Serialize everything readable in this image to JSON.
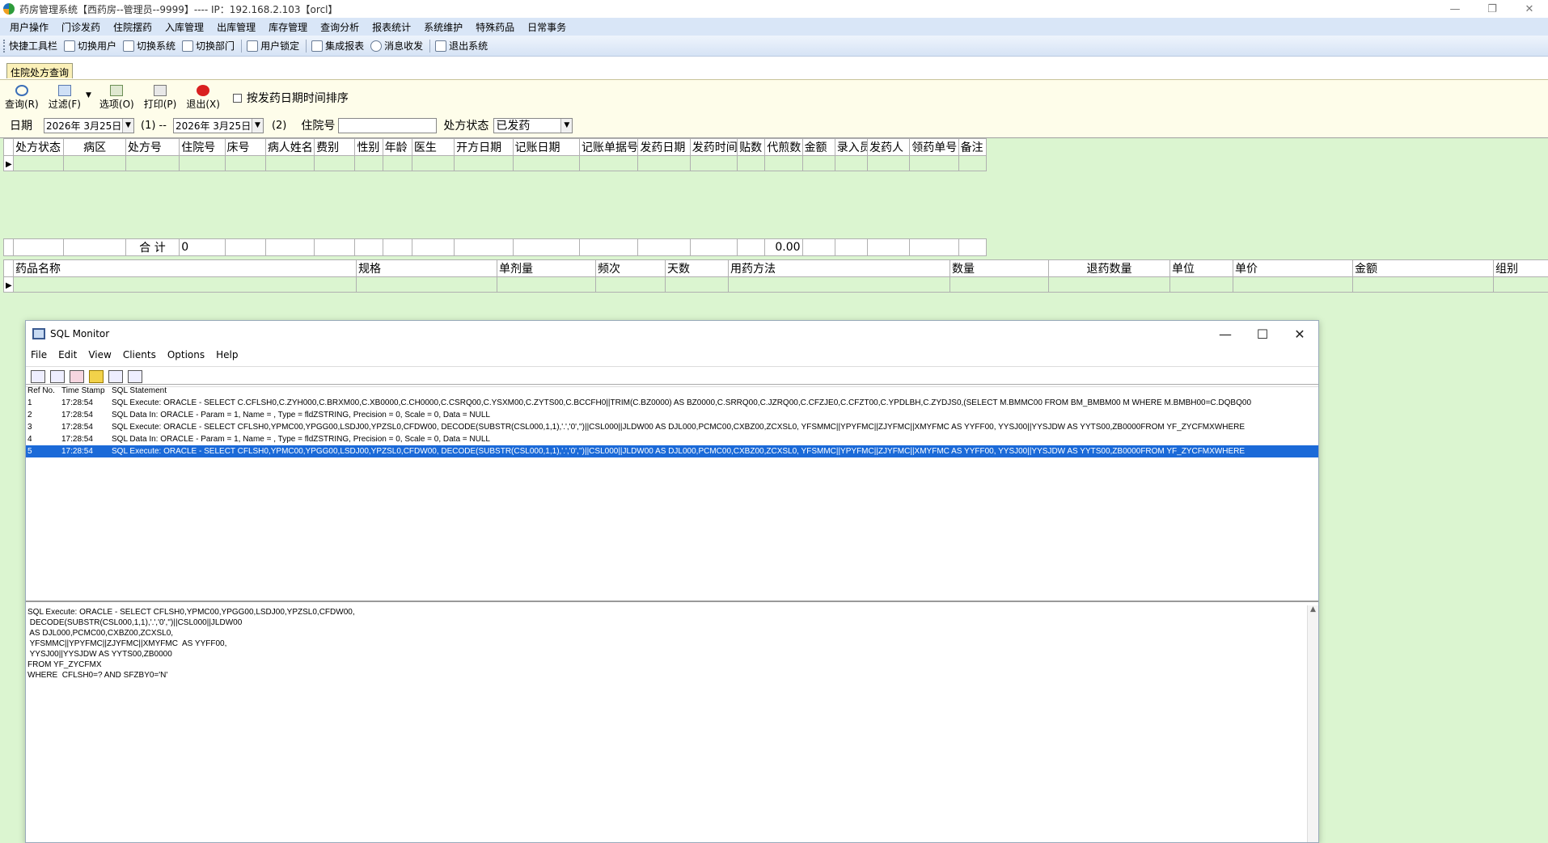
{
  "window": {
    "title": "药房管理系统【西药房--管理员--9999】---- IP：192.168.2.103【orcl】",
    "min": "—",
    "max": "❐",
    "close": "✕"
  },
  "menu": [
    "用户操作",
    "门诊发药",
    "住院摆药",
    "入库管理",
    "出库管理",
    "库存管理",
    "查询分析",
    "报表统计",
    "系统维护",
    "特殊药品",
    "日常事务"
  ],
  "toolbar": [
    "快捷工具栏",
    "切换用户",
    "切换系统",
    "切换部门",
    "用户锁定",
    "集成报表",
    "消息收发",
    "退出系统"
  ],
  "doc_tab": "住院处方查询",
  "actions": {
    "query": "查询(R)",
    "filter": "过滤(F)",
    "options": "选项(O)",
    "print": "打印(P)",
    "exit": "退出(X)",
    "dropdown": "▼",
    "sort_checkbox": "按发药日期时间排序"
  },
  "filters": {
    "date_label": "日期",
    "date_from": "2026年 3月25日",
    "mark1": "(1) --",
    "date_to": "2026年 3月25日",
    "mark2": "(2)",
    "inpatient_label": "住院号",
    "inpatient_value": "",
    "status_label": "处方状态",
    "status_value": "已发药"
  },
  "grid1": {
    "columns": [
      "处方状态",
      "病区",
      "处方号",
      "住院号",
      "床号",
      "病人姓名",
      "费别",
      "性别",
      "年龄",
      "医生",
      "开方日期",
      "记账日期",
      "记账单据号",
      "发药日期",
      "发药时间",
      "贴数",
      "代煎数",
      "金额",
      "录入员",
      "发药人",
      "领药单号",
      "备注"
    ],
    "total_label": "合  计",
    "total_count": "0",
    "total_amount": "0.00"
  },
  "grid2": {
    "columns": [
      "药品名称",
      "规格",
      "单剂量",
      "频次",
      "天数",
      "用药方法",
      "数量",
      "退药数量",
      "单位",
      "单价",
      "金额",
      "组别"
    ]
  },
  "sql_monitor": {
    "title": "SQL Monitor",
    "menu": [
      "File",
      "Edit",
      "View",
      "Clients",
      "Options",
      "Help"
    ],
    "headers": [
      "Ref No.",
      "Time Stamp",
      "SQL Statement"
    ],
    "rows": [
      {
        "ref": "1",
        "time": "17:28:54",
        "sql": "SQL Execute: ORACLE - SELECT C.CFLSH0,C.ZYH000,C.BRXM00,C.XB0000,C.CH0000,C.CSRQ00,C.YSXM00,C.ZYTS00,C.BCCFH0||TRIM(C.BZ0000) AS BZ0000,C.SRRQ00,C.JZRQ00,C.CFZJE0,C.CFZT00,C.YPDLBH,C.ZYDJS0,(SELECT M.BMMC00 FROM BM_BMBM00 M WHERE M.BMBH00=C.DQBQ00"
      },
      {
        "ref": "2",
        "time": "17:28:54",
        "sql": "SQL Data In: ORACLE - Param = 1, Name = , Type = fldZSTRING, Precision = 0, Scale = 0, Data = NULL"
      },
      {
        "ref": "3",
        "time": "17:28:54",
        "sql": "SQL Execute: ORACLE - SELECT CFLSH0,YPMC00,YPGG00,LSDJ00,YPZSL0,CFDW00,  DECODE(SUBSTR(CSL000,1,1),'.','0','')||CSL000||JLDW00   AS DJL000,PCMC00,CXBZ00,ZCXSL0,  YFSMMC||YPYFMC||ZJYFMC||XMYFMC  AS YYFF00,  YYSJ00||YYSJDW AS YYTS00,ZB0000FROM YF_ZYCFMXWHERE"
      },
      {
        "ref": "4",
        "time": "17:28:54",
        "sql": "SQL Data In: ORACLE - Param = 1, Name = , Type = fldZSTRING, Precision = 0, Scale = 0, Data = NULL"
      },
      {
        "ref": "5",
        "time": "17:28:54",
        "sql": "SQL Execute: ORACLE - SELECT CFLSH0,YPMC00,YPGG00,LSDJ00,YPZSL0,CFDW00,  DECODE(SUBSTR(CSL000,1,1),'.','0','')||CSL000||JLDW00   AS DJL000,PCMC00,CXBZ00,ZCXSL0,  YFSMMC||YPYFMC||ZJYFMC||XMYFMC  AS YYFF00,  YYSJ00||YYSJDW AS YYTS00,ZB0000FROM YF_ZYCFMXWHERE"
      }
    ],
    "detail": "SQL Execute: ORACLE - SELECT CFLSH0,YPMC00,YPGG00,LSDJ00,YPZSL0,CFDW00,\n DECODE(SUBSTR(CSL000,1,1),'.','0','')||CSL000||JLDW00\n AS DJL000,PCMC00,CXBZ00,ZCXSL0,\n YFSMMC||YPYFMC||ZJYFMC||XMYFMC  AS YYFF00,\n YYSJ00||YYSJDW AS YYTS00,ZB0000\nFROM YF_ZYCFMX\nWHERE  CFLSH0=? AND SFZBY0='N'",
    "selected_row": 5
  }
}
